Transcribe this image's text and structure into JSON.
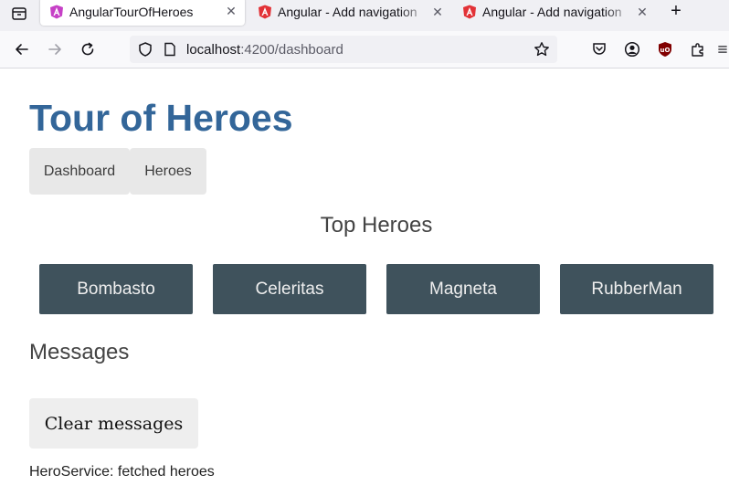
{
  "browser": {
    "tabs": [
      {
        "title": "AngularTourOfHeroes",
        "active": true,
        "icon": "angular-icon"
      },
      {
        "title": "Angular - Add navigation",
        "active": false,
        "icon": "angular-icon"
      },
      {
        "title": "Angular - Add navigation",
        "active": false,
        "icon": "angular-icon"
      }
    ],
    "url_host": "localhost",
    "url_path": ":4200/dashboard",
    "accent_color": "#336699"
  },
  "app": {
    "title": "Tour of Heroes",
    "nav": [
      {
        "label": "Dashboard"
      },
      {
        "label": "Heroes"
      }
    ],
    "section_title": "Top Heroes",
    "heroes": [
      {
        "name": "Bombasto"
      },
      {
        "name": "Celeritas"
      },
      {
        "name": "Magneta"
      },
      {
        "name": "RubberMan"
      }
    ],
    "messages": {
      "title": "Messages",
      "clear_label": "Clear messages",
      "items": [
        "HeroService: fetched heroes"
      ]
    }
  }
}
